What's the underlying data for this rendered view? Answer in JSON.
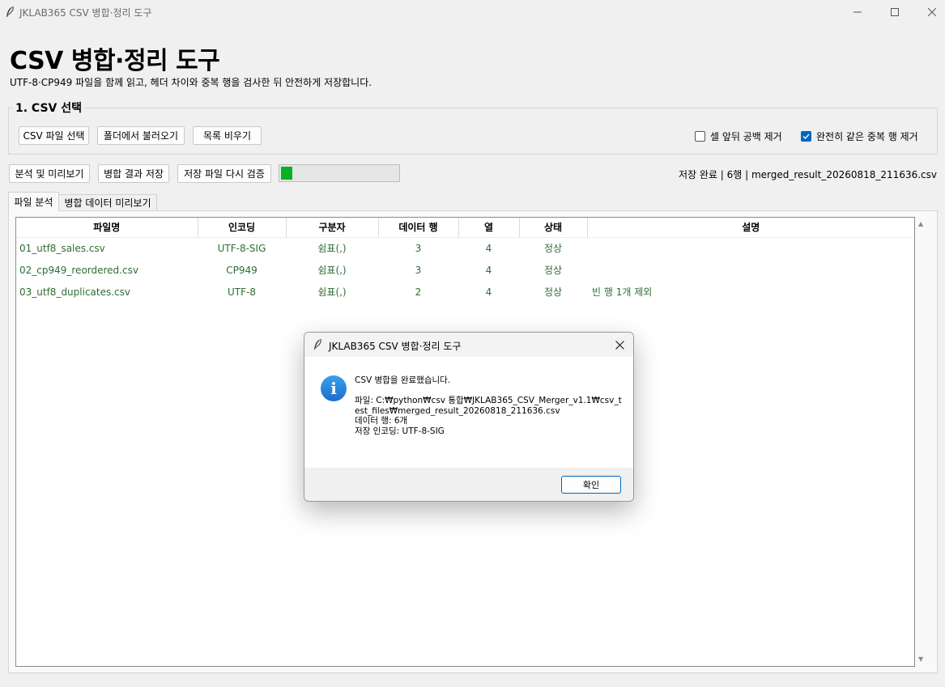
{
  "window": {
    "title": "JKLAB365 CSV 병합·정리 도구"
  },
  "header": {
    "title": "CSV 병합·정리 도구",
    "subtitle": "UTF-8·CP949 파일을 함께 읽고, 헤더 차이와 중복 행을 검사한 뒤 안전하게 저장합니다."
  },
  "select_group": {
    "title": "1. CSV 선택",
    "buttons": {
      "select_files": "CSV 파일 선택",
      "load_folder": "폴더에서 불러오기",
      "clear_list": "목록 비우기"
    },
    "options": {
      "trim_spaces": {
        "label": "셀 앞뒤 공백 제거",
        "checked": false
      },
      "remove_duplicates": {
        "label": "완전히 같은 중복 행 제거",
        "checked": true
      }
    }
  },
  "actions": {
    "analyze": "분석 및 미리보기",
    "save": "병합 결과 저장",
    "verify": "저장 파일 다시 검증",
    "progress_fraction": 0.1,
    "status": "저장 완료 | 6행 | merged_result_20260818_211636.csv"
  },
  "tabs": {
    "analysis": "파일 분석",
    "preview": "병합 데이터 미리보기"
  },
  "table": {
    "headers": {
      "filename": "파일명",
      "encoding": "인코딩",
      "delimiter": "구분자",
      "rows": "데이터 행",
      "cols": "열",
      "status": "상태",
      "note": "설명"
    },
    "rows": [
      {
        "filename": "01_utf8_sales.csv",
        "encoding": "UTF-8-SIG",
        "delimiter": "쉼표(,)",
        "rows": "3",
        "cols": "4",
        "status": "정상",
        "note": ""
      },
      {
        "filename": "02_cp949_reordered.csv",
        "encoding": "CP949",
        "delimiter": "쉼표(,)",
        "rows": "3",
        "cols": "4",
        "status": "정상",
        "note": ""
      },
      {
        "filename": "03_utf8_duplicates.csv",
        "encoding": "UTF-8",
        "delimiter": "쉼표(,)",
        "rows": "2",
        "cols": "4",
        "status": "정상",
        "note": "빈 행 1개 제외"
      }
    ]
  },
  "dialog": {
    "title": "JKLAB365 CSV 병합·정리 도구",
    "icon": "info-icon",
    "message": "CSV 병합을 완료했습니다.\n\n파일: C:₩python₩csv 통합₩JKLAB365_CSV_Merger_v1.1₩csv_test_files₩merged_result_20260818_211636.csv\n데이터 행: 6개\n저장 인코딩: UTF-8-SIG",
    "ok": "확인"
  }
}
